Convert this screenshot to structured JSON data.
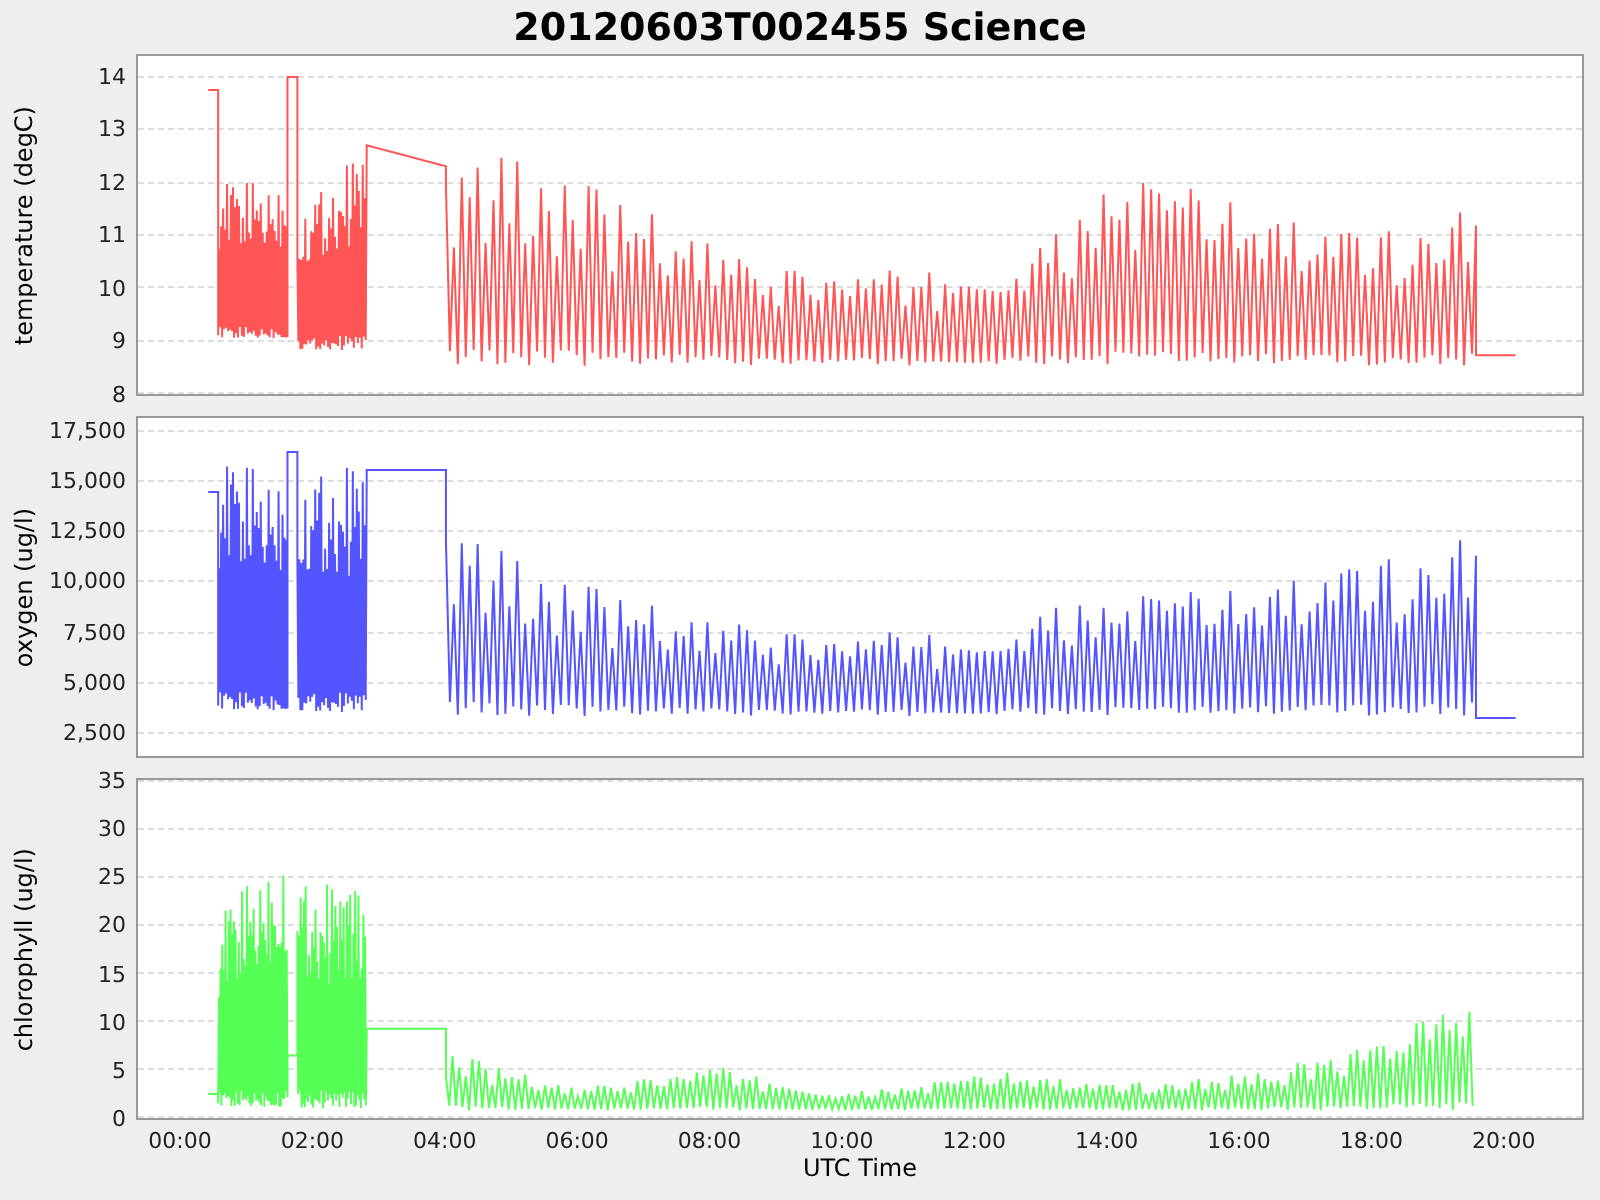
{
  "title": "20120603T002455 Science",
  "panels": [
    {
      "kind": "temperature",
      "label": "temperature (degC)",
      "color": "#ff5555",
      "yticks": [
        "14",
        "13",
        "12",
        "11",
        "10",
        "9",
        "8"
      ]
    },
    {
      "kind": "oxygen",
      "label": "oxygen (ug/l)",
      "color": "#5555ff",
      "yticks": [
        "17,500",
        "15,000",
        "12,500",
        "10,000",
        "7,500",
        "5,000",
        "2,500"
      ]
    },
    {
      "kind": "chlorophyll",
      "label": "chlorophyll (ug/l)",
      "color": "#55ff55",
      "yticks": [
        "35",
        "30",
        "25",
        "20",
        "15",
        "10",
        "5",
        "0"
      ]
    }
  ],
  "x_axis": {
    "label": "UTC Time",
    "ticks": [
      "00:00",
      "02:00",
      "04:00",
      "06:00",
      "08:00",
      "10:00",
      "12:00",
      "14:00",
      "16:00",
      "18:00",
      "20:00"
    ]
  }
}
